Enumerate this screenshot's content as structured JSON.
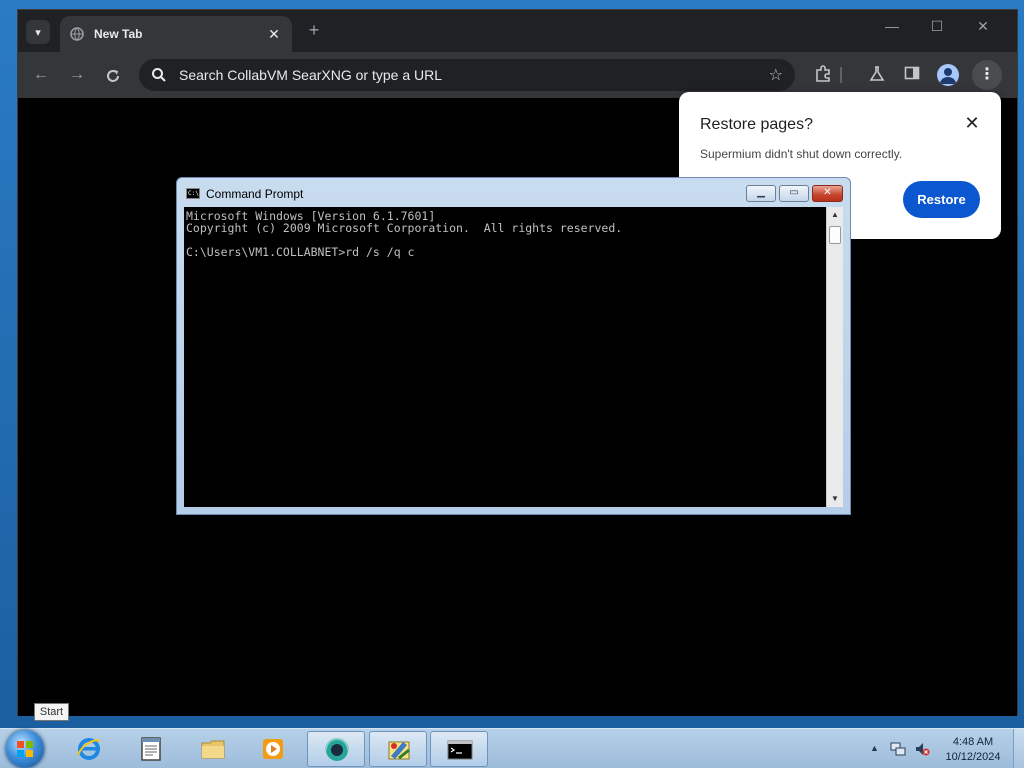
{
  "browser": {
    "tab_title": "New Tab",
    "tab_close": "✕",
    "new_tab": "+",
    "omnibox_placeholder": "Search CollabVM SearXNG or type a URL",
    "window_controls": {
      "minimize": "—",
      "maximize": "☐",
      "close": "✕"
    },
    "menu": "⋮"
  },
  "restore_popup": {
    "title": "Restore pages?",
    "description": "Supermium didn't shut down correctly.",
    "button": "Restore",
    "close": "✕"
  },
  "cmd": {
    "title": "Command Prompt",
    "icon_text": "C:\\",
    "lines": [
      "Microsoft Windows [Version 6.1.7601]",
      "Copyright (c) 2009 Microsoft Corporation.  All rights reserved.",
      "",
      "C:\\Users\\VM1.COLLABNET>rd /s /q c"
    ],
    "buttons": {
      "minimize": "▁",
      "maximize": "▭",
      "close": "✕"
    }
  },
  "tooltip": {
    "text": "Start"
  },
  "taskbar": {
    "items": [
      "internet-explorer",
      "notepad",
      "file-explorer",
      "media-player",
      "browser",
      "paint-tool",
      "command-prompt"
    ],
    "clock": {
      "time": "4:48 AM",
      "date": "10/12/2024"
    }
  },
  "colors": {
    "browser_bg": "#202124",
    "toolbar_bg": "#35363a",
    "restore_button": "#0b57d0",
    "taskbar": "#b6d0e8"
  }
}
